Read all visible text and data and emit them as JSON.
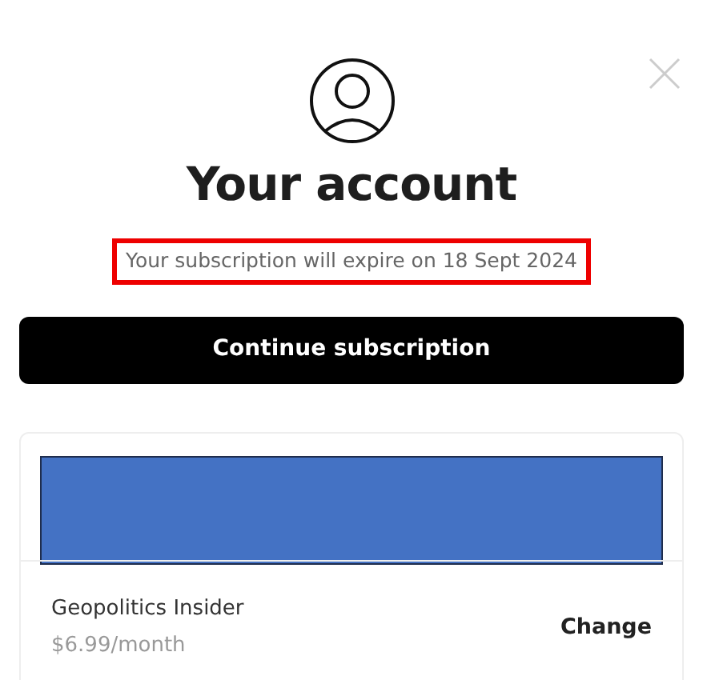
{
  "dialog": {
    "title": "Your account",
    "notice": {
      "text": "Your subscription will expire on 18 Sept 2024",
      "highlighted": true
    },
    "primary_button": "Continue subscription",
    "plan": {
      "redacted": true,
      "name": "Geopolitics Insider",
      "price": "$6.99/month",
      "action": "Change"
    }
  }
}
